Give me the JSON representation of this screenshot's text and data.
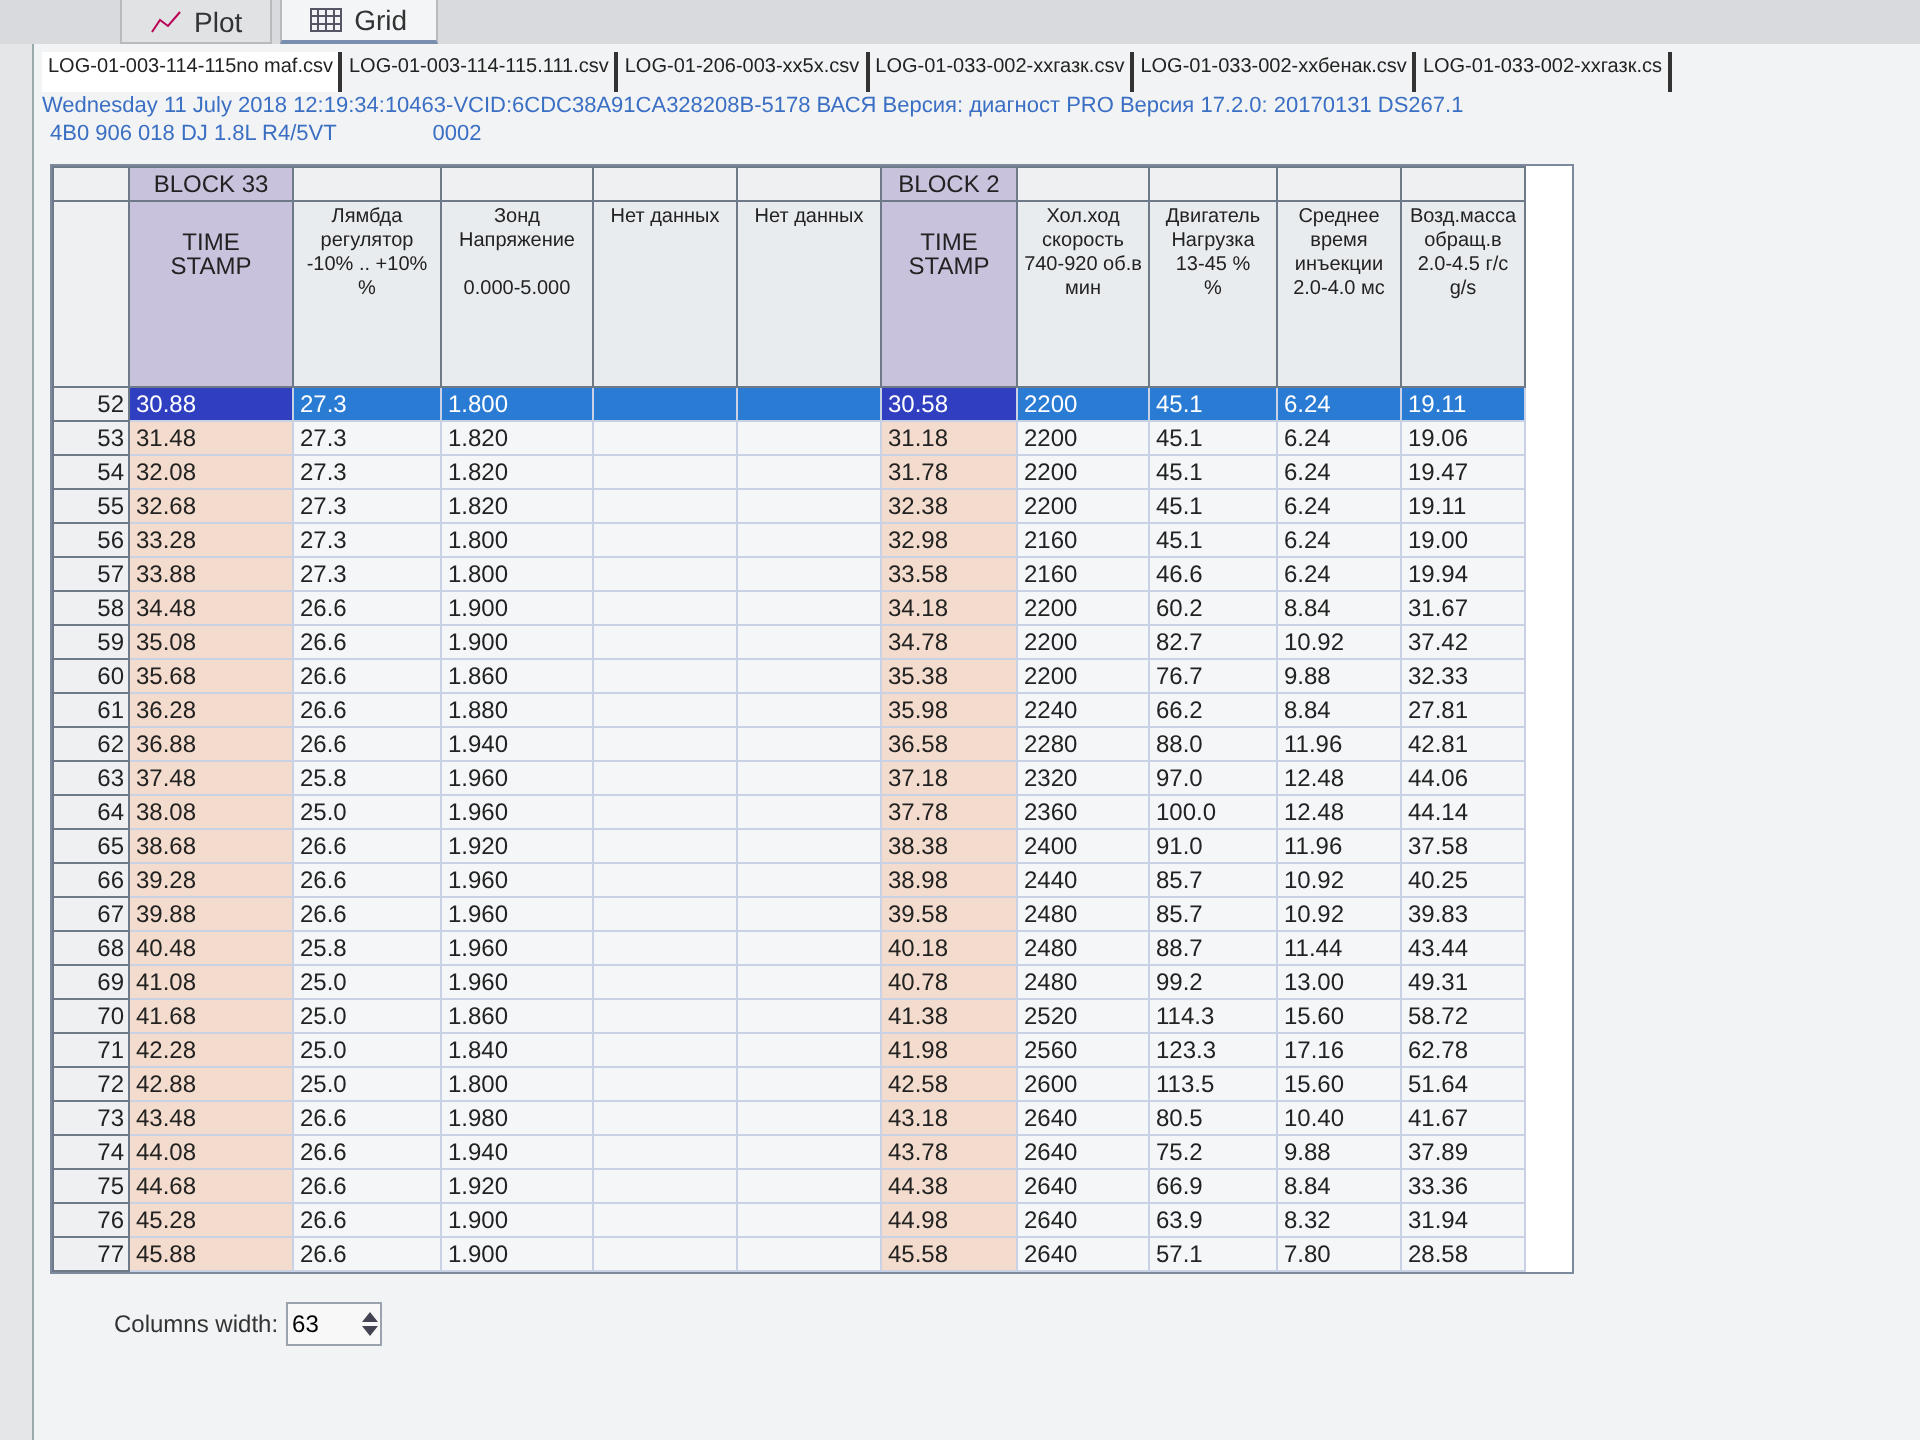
{
  "view_tabs": [
    {
      "label": "Plot",
      "selected": false
    },
    {
      "label": "Grid",
      "selected": true
    }
  ],
  "file_tabs": [
    {
      "label": "LOG-01-003-114-115no maf.csv",
      "selected": true
    },
    {
      "label": "LOG-01-003-114-115.111.csv",
      "selected": false
    },
    {
      "label": "LOG-01-206-003-xx5x.csv",
      "selected": false
    },
    {
      "label": "LOG-01-033-002-ххгазк.csv",
      "selected": false
    },
    {
      "label": "LOG-01-033-002-ххбенак.csv",
      "selected": false
    },
    {
      "label": "LOG-01-033-002-ххгазк.cs",
      "selected": false
    }
  ],
  "info": {
    "line_1": "Wednesday 11 July 2018 12:19:34:10463-VCID:6CDC38A91CA328208B-5178 ВАСЯ Версия: диагност PRO Версия 17.2.0: 20170131 DS267.1",
    "engine": "4B0 906 018 DJ  1.8L R4/5VT",
    "code": "0002"
  },
  "grid": {
    "groups": [
      {
        "label": "BLOCK 33",
        "columns": [
          "TIME\nSTAMP",
          "Лямбда\nрегулятор\n-10% .. +10%\n%",
          "Зонд\nНапряжение\n\n0.000-5.000",
          "Нет данных",
          "Нет данных"
        ]
      },
      {
        "label": "BLOCK 2",
        "columns": [
          "TIME\nSTAMP",
          "Хол.ход\nскорость\n740-920 об.в\nмин",
          "Двигатель\nНагрузка\n13-45 %\n%",
          "Среднее\nвремя\nинъекции\n2.0-4.0 мс",
          "Возд.масса\nобращ.в\n2.0-4.5 г/с\ng/s"
        ]
      }
    ],
    "rows": [
      {
        "number": "52",
        "selected": true,
        "block_33": [
          "30.88",
          "27.3",
          "1.800"
        ],
        "block_2": [
          "30.58",
          "2200",
          "45.1",
          "6.24",
          "19.11"
        ]
      },
      {
        "number": "53",
        "selected": false,
        "block_33": [
          "31.48",
          "27.3",
          "1.820"
        ],
        "block_2": [
          "31.18",
          "2200",
          "45.1",
          "6.24",
          "19.06"
        ]
      },
      {
        "number": "54",
        "selected": false,
        "block_33": [
          "32.08",
          "27.3",
          "1.820"
        ],
        "block_2": [
          "31.78",
          "2200",
          "45.1",
          "6.24",
          "19.47"
        ]
      },
      {
        "number": "55",
        "selected": false,
        "block_33": [
          "32.68",
          "27.3",
          "1.820"
        ],
        "block_2": [
          "32.38",
          "2200",
          "45.1",
          "6.24",
          "19.11"
        ]
      },
      {
        "number": "56",
        "selected": false,
        "block_33": [
          "33.28",
          "27.3",
          "1.800"
        ],
        "block_2": [
          "32.98",
          "2160",
          "45.1",
          "6.24",
          "19.00"
        ]
      },
      {
        "number": "57",
        "selected": false,
        "block_33": [
          "33.88",
          "27.3",
          "1.800"
        ],
        "block_2": [
          "33.58",
          "2160",
          "46.6",
          "6.24",
          "19.94"
        ]
      },
      {
        "number": "58",
        "selected": false,
        "block_33": [
          "34.48",
          "26.6",
          "1.900"
        ],
        "block_2": [
          "34.18",
          "2200",
          "60.2",
          "8.84",
          "31.67"
        ]
      },
      {
        "number": "59",
        "selected": false,
        "block_33": [
          "35.08",
          "26.6",
          "1.900"
        ],
        "block_2": [
          "34.78",
          "2200",
          "82.7",
          "10.92",
          "37.42"
        ]
      },
      {
        "number": "60",
        "selected": false,
        "block_33": [
          "35.68",
          "26.6",
          "1.860"
        ],
        "block_2": [
          "35.38",
          "2200",
          "76.7",
          "9.88",
          "32.33"
        ]
      },
      {
        "number": "61",
        "selected": false,
        "block_33": [
          "36.28",
          "26.6",
          "1.880"
        ],
        "block_2": [
          "35.98",
          "2240",
          "66.2",
          "8.84",
          "27.81"
        ]
      },
      {
        "number": "62",
        "selected": false,
        "block_33": [
          "36.88",
          "26.6",
          "1.940"
        ],
        "block_2": [
          "36.58",
          "2280",
          "88.0",
          "11.96",
          "42.81"
        ]
      },
      {
        "number": "63",
        "selected": false,
        "block_33": [
          "37.48",
          "25.8",
          "1.960"
        ],
        "block_2": [
          "37.18",
          "2320",
          "97.0",
          "12.48",
          "44.06"
        ]
      },
      {
        "number": "64",
        "selected": false,
        "block_33": [
          "38.08",
          "25.0",
          "1.960"
        ],
        "block_2": [
          "37.78",
          "2360",
          "100.0",
          "12.48",
          "44.14"
        ]
      },
      {
        "number": "65",
        "selected": false,
        "block_33": [
          "38.68",
          "26.6",
          "1.920"
        ],
        "block_2": [
          "38.38",
          "2400",
          "91.0",
          "11.96",
          "37.58"
        ]
      },
      {
        "number": "66",
        "selected": false,
        "block_33": [
          "39.28",
          "26.6",
          "1.960"
        ],
        "block_2": [
          "38.98",
          "2440",
          "85.7",
          "10.92",
          "40.25"
        ]
      },
      {
        "number": "67",
        "selected": false,
        "block_33": [
          "39.88",
          "26.6",
          "1.960"
        ],
        "block_2": [
          "39.58",
          "2480",
          "85.7",
          "10.92",
          "39.83"
        ]
      },
      {
        "number": "68",
        "selected": false,
        "block_33": [
          "40.48",
          "25.8",
          "1.960"
        ],
        "block_2": [
          "40.18",
          "2480",
          "88.7",
          "11.44",
          "43.44"
        ]
      },
      {
        "number": "69",
        "selected": false,
        "block_33": [
          "41.08",
          "25.0",
          "1.960"
        ],
        "block_2": [
          "40.78",
          "2480",
          "99.2",
          "13.00",
          "49.31"
        ]
      },
      {
        "number": "70",
        "selected": false,
        "block_33": [
          "41.68",
          "25.0",
          "1.860"
        ],
        "block_2": [
          "41.38",
          "2520",
          "114.3",
          "15.60",
          "58.72"
        ]
      },
      {
        "number": "71",
        "selected": false,
        "block_33": [
          "42.28",
          "25.0",
          "1.840"
        ],
        "block_2": [
          "41.98",
          "2560",
          "123.3",
          "17.16",
          "62.78"
        ]
      },
      {
        "number": "72",
        "selected": false,
        "block_33": [
          "42.88",
          "25.0",
          "1.800"
        ],
        "block_2": [
          "42.58",
          "2600",
          "113.5",
          "15.60",
          "51.64"
        ]
      },
      {
        "number": "73",
        "selected": false,
        "block_33": [
          "43.48",
          "26.6",
          "1.980"
        ],
        "block_2": [
          "43.18",
          "2640",
          "80.5",
          "10.40",
          "41.67"
        ]
      },
      {
        "number": "74",
        "selected": false,
        "block_33": [
          "44.08",
          "26.6",
          "1.940"
        ],
        "block_2": [
          "43.78",
          "2640",
          "75.2",
          "9.88",
          "37.89"
        ]
      },
      {
        "number": "75",
        "selected": false,
        "block_33": [
          "44.68",
          "26.6",
          "1.920"
        ],
        "block_2": [
          "44.38",
          "2640",
          "66.9",
          "8.84",
          "33.36"
        ]
      },
      {
        "number": "76",
        "selected": false,
        "block_33": [
          "45.28",
          "26.6",
          "1.900"
        ],
        "block_2": [
          "44.98",
          "2640",
          "63.9",
          "8.32",
          "31.94"
        ]
      },
      {
        "number": "77",
        "selected": false,
        "block_33": [
          "45.88",
          "26.6",
          "1.900"
        ],
        "block_2": [
          "45.58",
          "2640",
          "57.1",
          "7.80",
          "28.58"
        ]
      }
    ]
  },
  "footer": {
    "label": "Columns width:",
    "value": "63"
  }
}
